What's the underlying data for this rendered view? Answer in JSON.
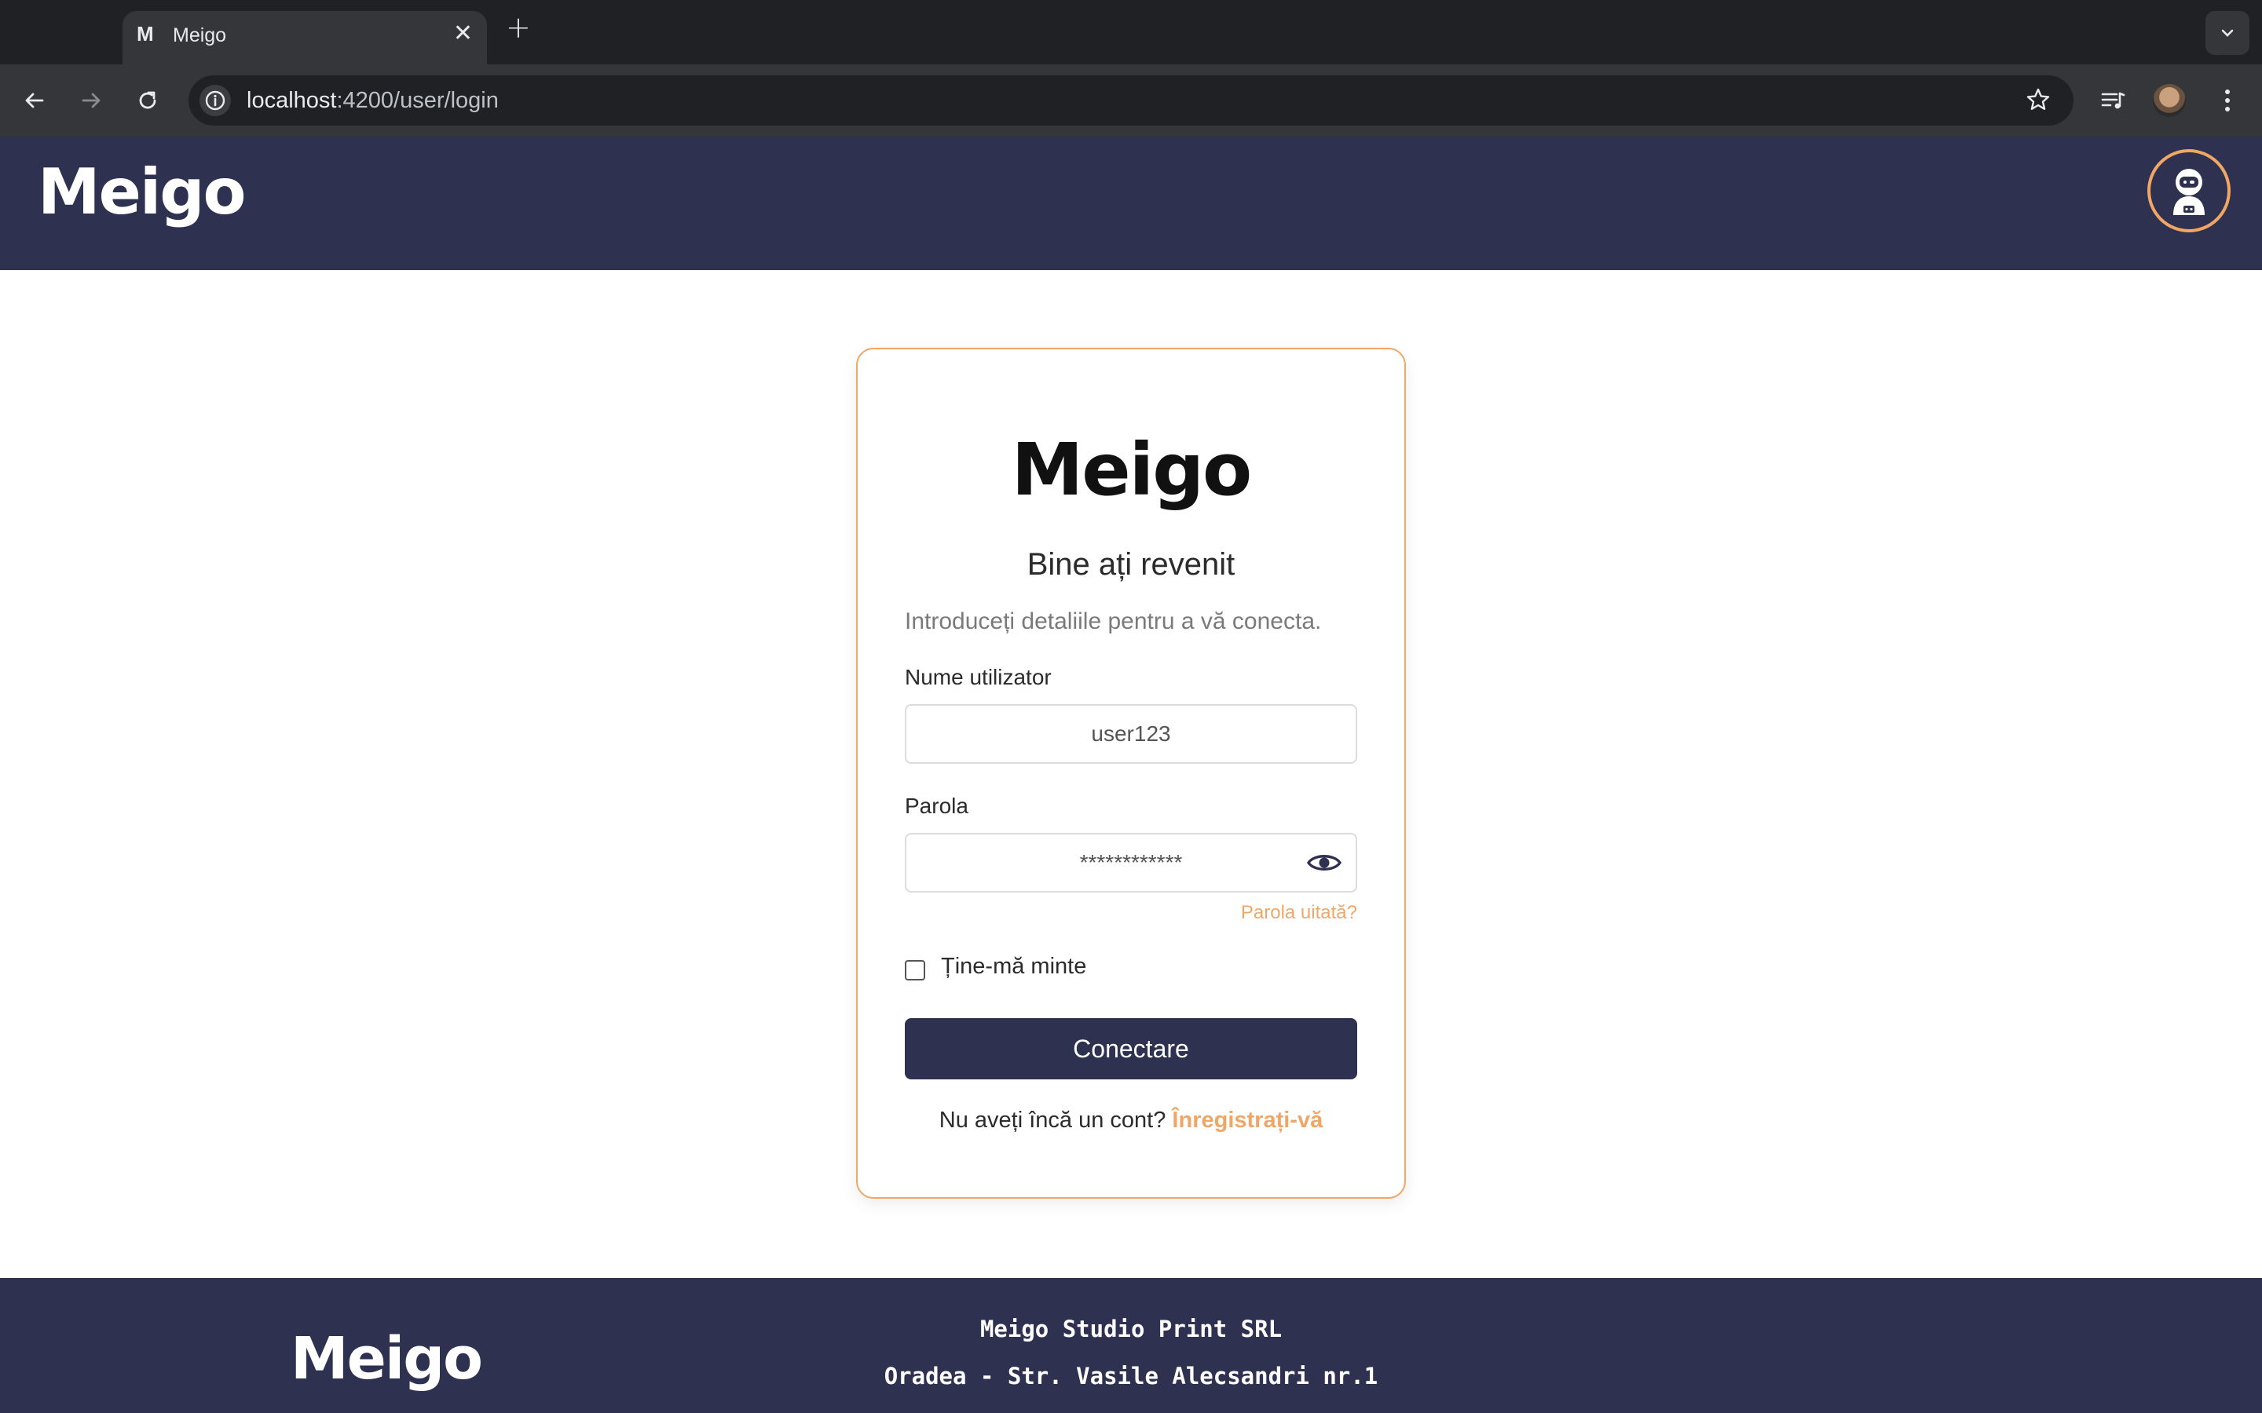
{
  "browser": {
    "tab_favicon": "M",
    "tab_title": "Meigo",
    "tab_close": "✕",
    "new_tab": "+",
    "url_host": "localhost",
    "url_rest": ":4200/user/login"
  },
  "header": {
    "logo": "Meigo"
  },
  "login": {
    "logo": "Meigo",
    "title": "Bine ați revenit",
    "subtitle": "Introduceți detaliile pentru a vă conecta.",
    "username_label": "Nume utilizator",
    "username_value": "user123",
    "password_label": "Parola",
    "password_value": "************",
    "forgot_password": "Parola uitată?",
    "remember_me": "Ține-mă minte",
    "submit": "Conectare",
    "no_account": "Nu aveți încă un cont?",
    "register": "Înregistrați-vă"
  },
  "footer": {
    "logo": "Meigo",
    "company": "Meigo Studio Print SRL",
    "address": "Oradea - Str. Vasile Alecsandri nr.1"
  },
  "colors": {
    "navy": "#2f3150",
    "accent": "#f0a765",
    "chrome_dark": "#202124",
    "chrome_toolbar": "#35363a"
  },
  "icons": {
    "back": "arrow-left-icon",
    "forward": "arrow-right-icon",
    "reload": "reload-icon",
    "site_info": "info-icon",
    "bookmark": "star-icon",
    "media": "media-control-icon",
    "menu": "kebab-menu-icon",
    "tab_search": "chevron-down-icon",
    "user": "astronaut-avatar-icon",
    "toggle_password": "eye-icon"
  }
}
